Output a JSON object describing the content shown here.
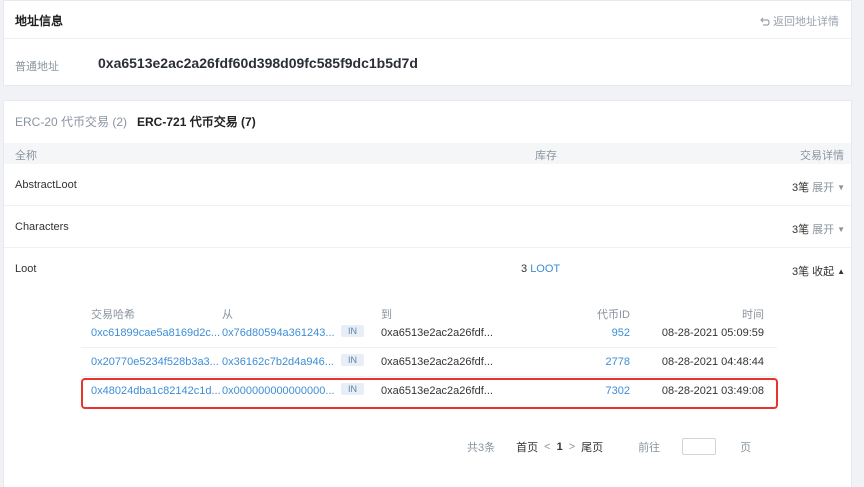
{
  "address_card": {
    "title": "地址信息",
    "back_label": "返回地址详情",
    "addr_label": "普通地址",
    "address": "0xa6513e2ac2a26fdf60d398d09fc585f9dc1b5d7d"
  },
  "tabs": [
    {
      "label": "ERC-20 代币交易 (2)",
      "active": false
    },
    {
      "label": "ERC-721 代币交易 (7)",
      "active": true
    }
  ],
  "table": {
    "headers": {
      "name": "全称",
      "stock": "库存",
      "detail": "交易详情"
    },
    "rows": [
      {
        "name": "AbstractLoot",
        "stock": "",
        "stock_unit": "",
        "count": "3笔",
        "action": "展开",
        "caret": "▼"
      },
      {
        "name": "Characters",
        "stock": "",
        "stock_unit": "",
        "count": "3笔",
        "action": "展开",
        "caret": "▼"
      },
      {
        "name": "Loot",
        "stock": "3",
        "stock_unit": "LOOT",
        "count": "3笔",
        "action": "收起",
        "caret": "▲"
      }
    ]
  },
  "sub_table": {
    "headers": {
      "hash": "交易哈希",
      "from": "从",
      "to": "到",
      "token_id": "代币ID",
      "time": "时间"
    },
    "rows": [
      {
        "hash": "0xc61899cae5a8169d2c...",
        "from": "0x76d80594a361243...",
        "dir": "IN",
        "to": "0xa6513e2ac2a26fdf...",
        "token_id": "952",
        "time": "08-28-2021 05:09:59"
      },
      {
        "hash": "0x20770e5234f528b3a3...",
        "from": "0x36162c7b2d4a946...",
        "dir": "IN",
        "to": "0xa6513e2ac2a26fdf...",
        "token_id": "2778",
        "time": "08-28-2021 04:48:44"
      },
      {
        "hash": "0x48024dba1c82142c1d...",
        "from": "0x000000000000000...",
        "dir": "IN",
        "to": "0xa6513e2ac2a26fdf...",
        "token_id": "7302",
        "time": "08-28-2021 03:49:08"
      }
    ]
  },
  "pager": {
    "total": "共3条",
    "first": "首页",
    "prev": "<",
    "current": "1",
    "next": ">",
    "last": "尾页",
    "goto": "前往",
    "unit": "页"
  },
  "colors": {
    "link": "#3d8ed6",
    "highlight": "#e8342a"
  }
}
